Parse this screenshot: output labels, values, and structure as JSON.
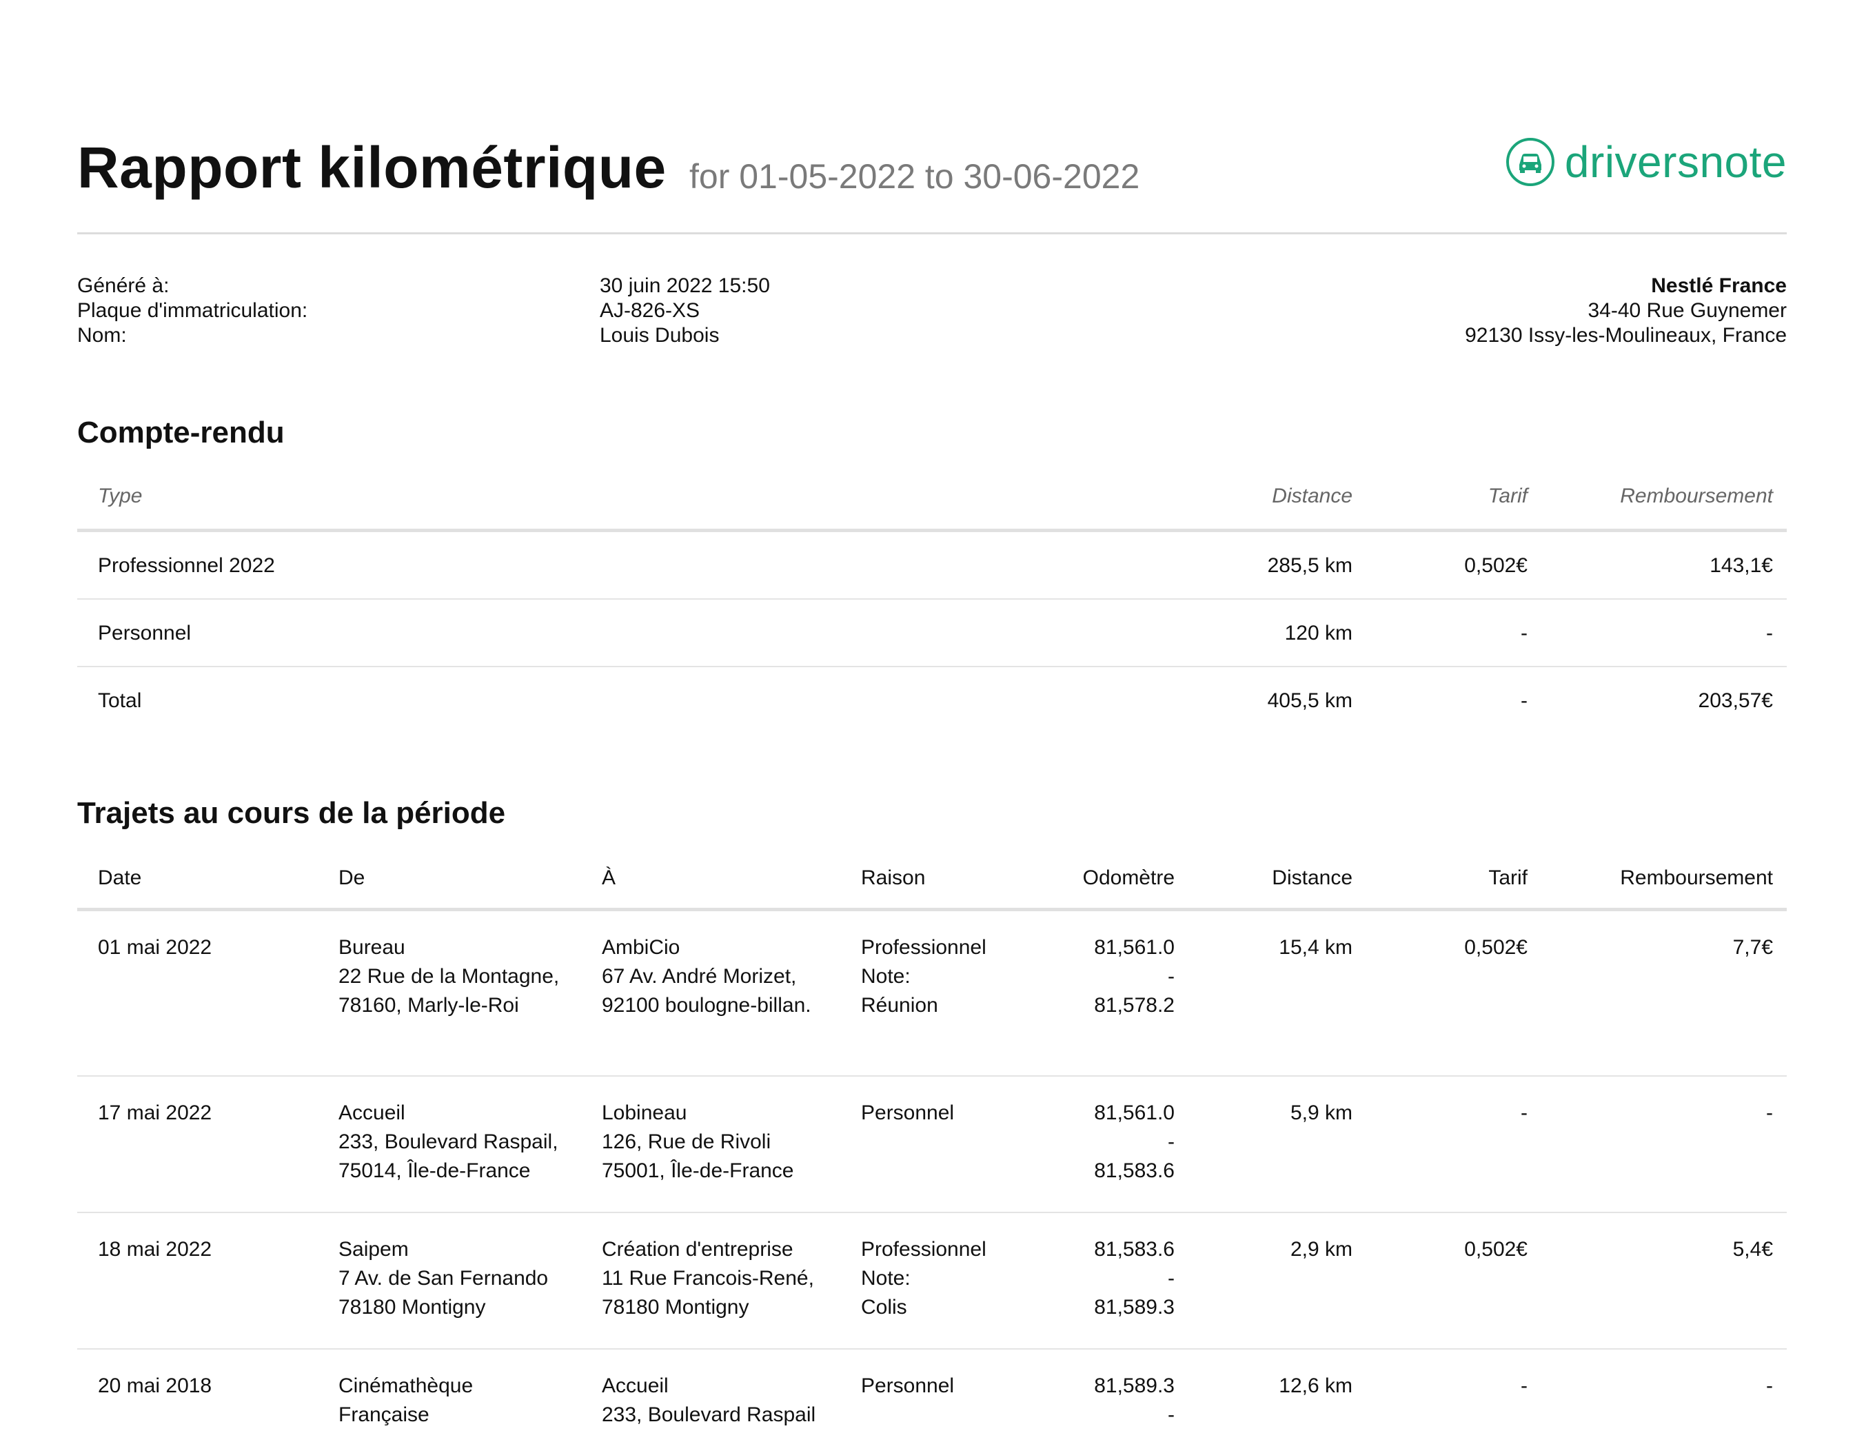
{
  "header": {
    "title": "Rapport kilométrique",
    "period": "for 01-05-2022 to 30-06-2022",
    "brand": "driversnote",
    "brand_icon": "car-icon",
    "brand_color": "#1ba57a"
  },
  "meta": {
    "generated_label": "Généré à:",
    "plate_label": "Plaque d'immatriculation:",
    "name_label": "Nom:",
    "generated_value": "30 juin 2022 15:50",
    "plate_value": "AJ-826-XS",
    "name_value": "Louis Dubois"
  },
  "company": {
    "name": "Nestlé France",
    "address1": "34-40 Rue Guynemer",
    "address2": "92130 Issy-les-Moulineaux, France"
  },
  "summary": {
    "title": "Compte-rendu",
    "headers": {
      "type": "Type",
      "distance": "Distance",
      "rate": "Tarif",
      "reimbursement": "Remboursement"
    },
    "rows": [
      {
        "type": "Professionnel 2022",
        "distance": "285,5 km",
        "rate": "0,502€",
        "reimbursement": "143,1€"
      },
      {
        "type": "Personnel",
        "distance": "120 km",
        "rate": "-",
        "reimbursement": "-"
      },
      {
        "type": "Total",
        "distance": "405,5 km",
        "rate": "-",
        "reimbursement": "203,57€"
      }
    ]
  },
  "trips": {
    "title": "Trajets au cours de la période",
    "headers": {
      "date": "Date",
      "from": "De",
      "to": "À",
      "reason": "Raison",
      "odometer": "Odomètre",
      "distance": "Distance",
      "rate": "Tarif",
      "reimbursement": "Remboursement"
    },
    "rows": [
      {
        "date": "01 mai 2022",
        "from": [
          "Bureau",
          "22 Rue de la Montagne,",
          "78160, Marly-le-Roi"
        ],
        "to": [
          "AmbiCio",
          "67 Av. André Morizet,",
          "92100 boulogne-billan."
        ],
        "reason": [
          "Professionnel",
          "Note:",
          "Réunion"
        ],
        "odometer": [
          "81,561.0",
          "-",
          "81,578.2"
        ],
        "distance": "15,4 km",
        "rate": "0,502€",
        "reimbursement": "7,7€"
      },
      {
        "date": "17 mai 2022",
        "from": [
          "Accueil",
          "233, Boulevard Raspail,",
          "75014, Île-de-France"
        ],
        "to": [
          "Lobineau",
          "126, Rue de Rivoli",
          "75001, Île-de-France"
        ],
        "reason": [
          "Personnel"
        ],
        "odometer": [
          "81,561.0",
          "-",
          "81,583.6"
        ],
        "distance": "5,9 km",
        "rate": "-",
        "reimbursement": "-"
      },
      {
        "date": "18 mai 2022",
        "from": [
          "Saipem",
          "7 Av. de San Fernando",
          "78180 Montigny"
        ],
        "to": [
          "Création d'entreprise",
          "11 Rue Francois-René,",
          "78180 Montigny"
        ],
        "reason": [
          "Professionnel",
          "Note:",
          "Colis"
        ],
        "odometer": [
          "81,583.6",
          "-",
          "81,589.3"
        ],
        "distance": "2,9 km",
        "rate": "0,502€",
        "reimbursement": "5,4€"
      },
      {
        "date": "20 mai 2018",
        "from": [
          "Cinémathèque",
          "Française"
        ],
        "to": [
          "Accueil",
          "233, Boulevard Raspail"
        ],
        "reason": [
          "Personnel"
        ],
        "odometer": [
          "81,589.3",
          "-"
        ],
        "distance": "12,6 km",
        "rate": "-",
        "reimbursement": "-"
      }
    ]
  }
}
